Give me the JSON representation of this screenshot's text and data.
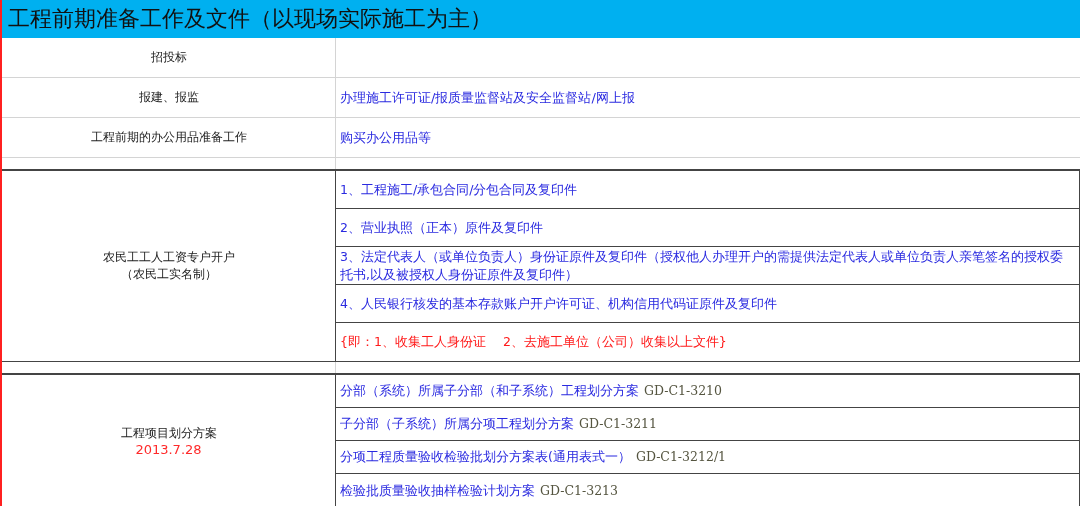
{
  "title": "工程前期准备工作及文件（以现场实际施工为主）",
  "rows": [
    {
      "kind": "simple",
      "label": "招投标"
    },
    {
      "kind": "simple",
      "label": "报建、报监",
      "value": "办理施工许可证/报质量监督站及安全监督站/网上报"
    },
    {
      "kind": "simple",
      "label": "工程前期的办公用品准备工作",
      "value": "购买办公用品等"
    },
    {
      "kind": "group",
      "label": "农民工工人工资专户开户",
      "sublabel": "（农民工实名制）",
      "items": [
        {
          "kind": "entry",
          "text": "1、工程施工/承包合同/分包合同及复印件"
        },
        {
          "kind": "entry",
          "text": "2、营业执照（正本）原件及复印件"
        },
        {
          "kind": "entry",
          "text": "3、法定代表人（或单位负责人）身份证原件及复印件（授权他人办理开户的需提供法定代表人或单位负责人亲笔签名的授权委托书,以及被授权人身份证原件及复印件）"
        },
        {
          "kind": "entry",
          "text": "4、人民银行核发的基本存款账户开户许可证、机构信用代码证原件及复印件"
        },
        {
          "kind": "note",
          "text": "{即：1、收集工人身份证　 2、去施工单位（公司）收集以上文件}"
        }
      ]
    },
    {
      "kind": "group",
      "label": "工程项目划分方案",
      "date": "2013.7.28",
      "items": [
        {
          "kind": "entry",
          "text": "分部（系统）所属子分部（和子系统）工程划分方案",
          "code": "GD-C1-3210"
        },
        {
          "kind": "entry",
          "text": "子分部（子系统）所属分项工程划分方案",
          "code": "GD-C1-3211"
        },
        {
          "kind": "entry",
          "text": "分项工程质量验收检验批划分方案表(通用表式一）",
          "code": "GD-C1-3212/1"
        },
        {
          "kind": "entry",
          "text": "检验批质量验收抽样检验计划方案",
          "code": "GD-C1-3213"
        }
      ]
    }
  ]
}
